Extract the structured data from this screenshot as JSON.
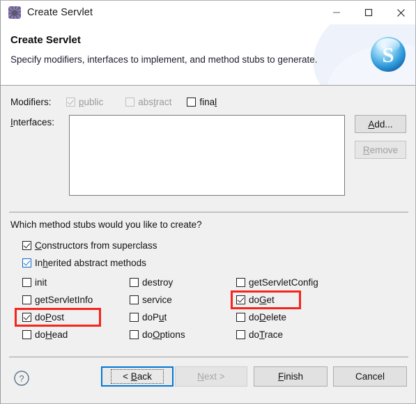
{
  "window": {
    "title": "Create Servlet",
    "icon": "servlet-gear-icon",
    "minimize_label": "—",
    "maximize_label": "□",
    "close_label": "✕"
  },
  "header": {
    "title": "Create Servlet",
    "description": "Specify modifiers, interfaces to implement, and method stubs to generate.",
    "logo": "skype-s-sphere-logo",
    "logo_letter": "S"
  },
  "modifiers": {
    "label": "Modifiers:",
    "items": [
      {
        "label": "public",
        "mnemonic": "p",
        "checked": true,
        "enabled": false
      },
      {
        "label": "abstract",
        "mnemonic": "t",
        "checked": false,
        "enabled": false
      },
      {
        "label": "final",
        "mnemonic": "l",
        "checked": false,
        "enabled": true
      }
    ]
  },
  "interfaces": {
    "label": "Interfaces:",
    "mnemonic": "I",
    "items": [],
    "add_label": "Add...",
    "add_mnemonic": "A",
    "remove_label": "Remove",
    "remove_mnemonic": "R",
    "remove_enabled": false
  },
  "method_stubs": {
    "question": "Which method stubs would you like to create?",
    "top_options": [
      {
        "label": "Constructors from superclass",
        "mnemonic": "C",
        "checked": true,
        "check_color": "dark"
      },
      {
        "label": "Inherited abstract methods",
        "mnemonic": "h",
        "checked": true,
        "check_color": "blue"
      }
    ],
    "columns": [
      [
        {
          "label": "init",
          "mnemonic": "",
          "checked": false,
          "highlighted": false
        },
        {
          "label": "getServletInfo",
          "mnemonic": "",
          "checked": false,
          "highlighted": false
        },
        {
          "label": "doPost",
          "mnemonic": "P",
          "checked": true,
          "highlighted": true
        },
        {
          "label": "doHead",
          "mnemonic": "H",
          "checked": false,
          "highlighted": false
        }
      ],
      [
        {
          "label": "destroy",
          "mnemonic": "",
          "checked": false,
          "highlighted": false
        },
        {
          "label": "service",
          "mnemonic": "",
          "checked": false,
          "highlighted": false
        },
        {
          "label": "doPut",
          "mnemonic": "u",
          "checked": false,
          "highlighted": false
        },
        {
          "label": "doOptions",
          "mnemonic": "O",
          "checked": false,
          "highlighted": false
        }
      ],
      [
        {
          "label": "getServletConfig",
          "mnemonic": "",
          "checked": false,
          "highlighted": false
        },
        {
          "label": "doGet",
          "mnemonic": "G",
          "checked": true,
          "highlighted": true
        },
        {
          "label": "doDelete",
          "mnemonic": "D",
          "checked": false,
          "highlighted": false
        },
        {
          "label": "doTrace",
          "mnemonic": "T",
          "checked": false,
          "highlighted": false
        }
      ]
    ]
  },
  "footer": {
    "help_icon": "help-question-icon",
    "buttons": [
      {
        "id": "back",
        "label": "< Back",
        "mnemonic": "B",
        "enabled": true,
        "default": true
      },
      {
        "id": "next",
        "label": "Next >",
        "mnemonic": "N",
        "enabled": false,
        "default": false
      },
      {
        "id": "finish",
        "label": "Finish",
        "mnemonic": "F",
        "enabled": true,
        "default": false
      },
      {
        "id": "cancel",
        "label": "Cancel",
        "mnemonic": "",
        "enabled": true,
        "default": false
      }
    ]
  },
  "annotations": {
    "color": "#f5241c",
    "boxes": [
      "doPost",
      "doGet"
    ]
  }
}
